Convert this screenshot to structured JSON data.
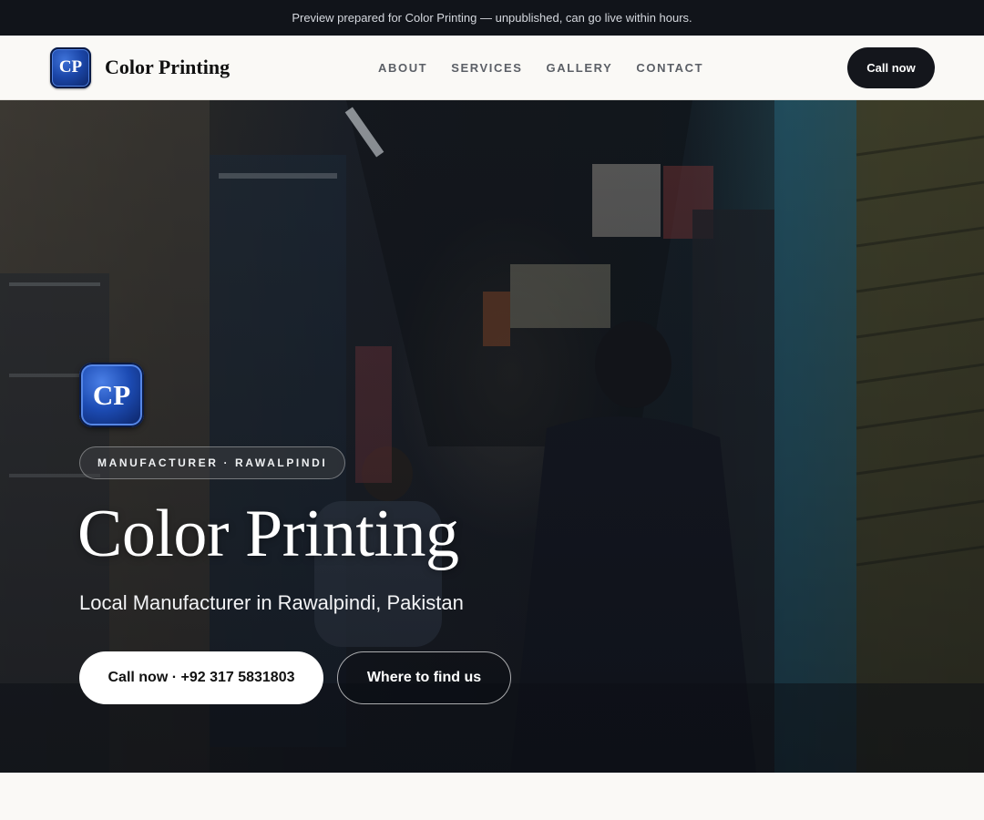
{
  "preview_banner": {
    "text": "Preview prepared for Color Printing — unpublished, can go live within hours."
  },
  "header": {
    "logo_text": "CP",
    "brand_name": "Color Printing",
    "nav": [
      {
        "label": "ABOUT"
      },
      {
        "label": "SERVICES"
      },
      {
        "label": "GALLERY"
      },
      {
        "label": "CONTACT"
      }
    ],
    "call_button": "Call now"
  },
  "hero": {
    "logo_text": "CP",
    "badge": "MANUFACTURER · RAWALPINDI",
    "title": "Color Printing",
    "subtitle": "Local Manufacturer in Rawalpindi, Pakistan",
    "primary_button": "Call now · +92 317 5831803",
    "secondary_button": "Where to find us"
  },
  "colors": {
    "banner_bg": "#11141a",
    "header_bg": "#faf9f6",
    "accent_dark": "#14161c",
    "logo_blue": "#1c4bb3",
    "hero_text": "#ffffff"
  },
  "icons": {
    "logo": "cp-logo-icon"
  }
}
